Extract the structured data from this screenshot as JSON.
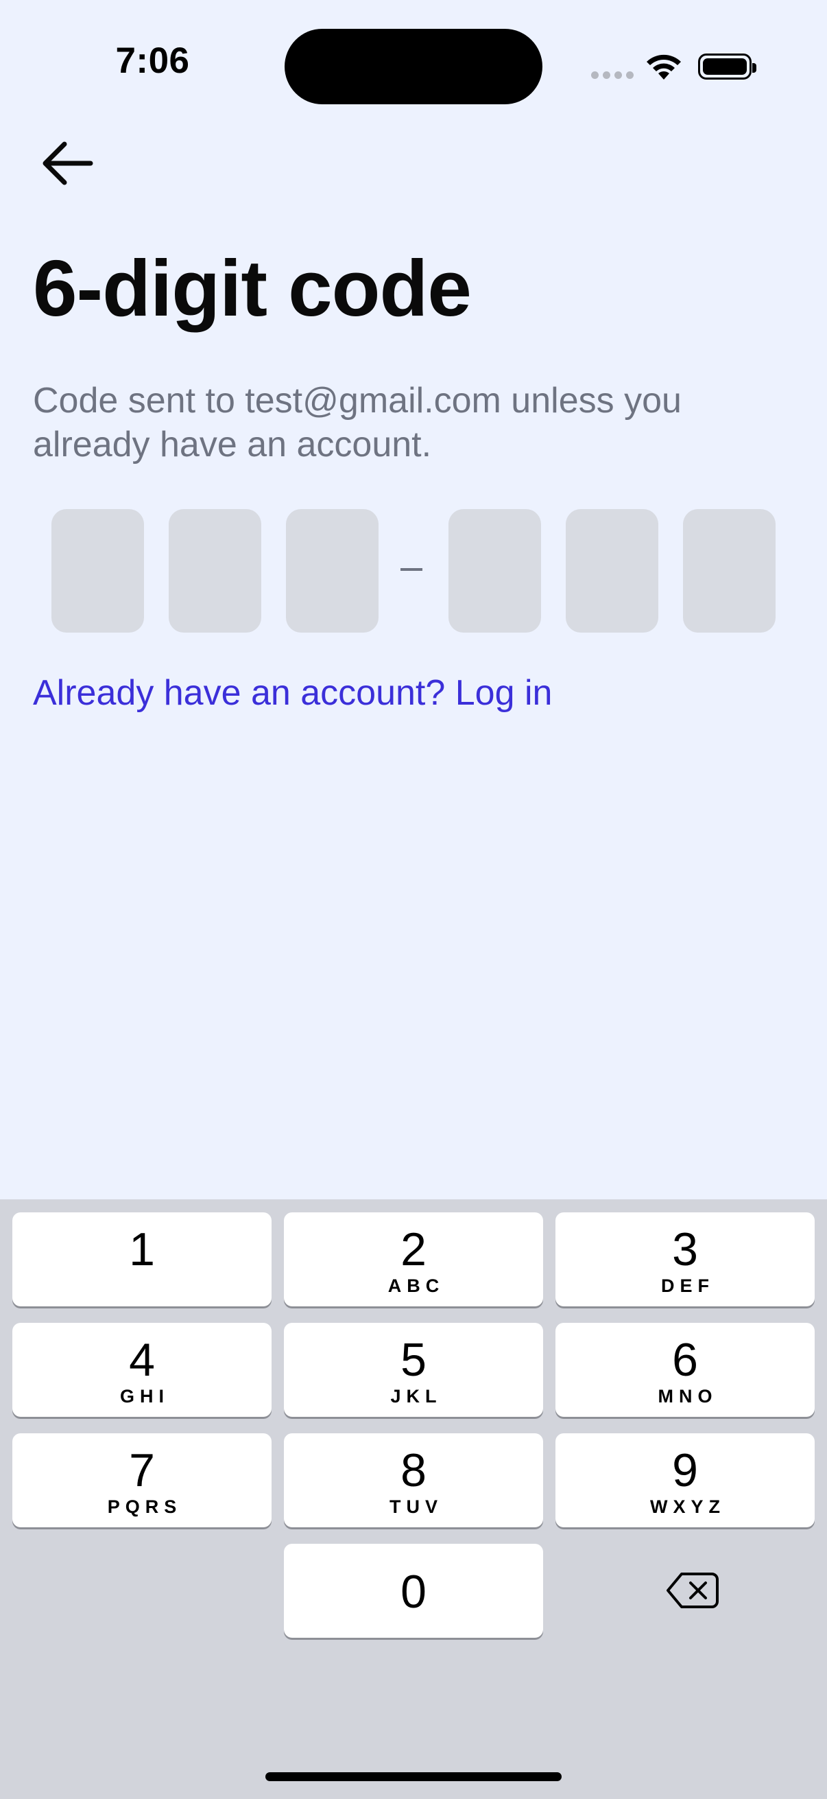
{
  "status_bar": {
    "time": "7:06",
    "signal_icon": "cellular-dots-icon",
    "wifi_icon": "wifi-icon",
    "battery_icon": "battery-full-icon"
  },
  "header": {
    "back_icon": "arrow-left-icon"
  },
  "main": {
    "title": "6-digit code",
    "subtitle": "Code sent to test@gmail.com unless you already have an account.",
    "code_separator": "–",
    "code_digits": [
      "",
      "",
      "",
      "",
      "",
      ""
    ],
    "login_link": "Already have an account? Log in"
  },
  "keypad": {
    "keys": [
      {
        "digit": "1",
        "letters": ""
      },
      {
        "digit": "2",
        "letters": "ABC"
      },
      {
        "digit": "3",
        "letters": "DEF"
      },
      {
        "digit": "4",
        "letters": "GHI"
      },
      {
        "digit": "5",
        "letters": "JKL"
      },
      {
        "digit": "6",
        "letters": "MNO"
      },
      {
        "digit": "7",
        "letters": "PQRS"
      },
      {
        "digit": "8",
        "letters": "TUV"
      },
      {
        "digit": "9",
        "letters": "WXYZ"
      },
      {
        "digit": "0",
        "letters": ""
      }
    ],
    "backspace_icon": "delete-backspace-icon"
  },
  "colors": {
    "background": "#EDF2FE",
    "link": "#3B2FD9",
    "subtitle": "#6E7381",
    "code_box": "#D8DBE2",
    "keypad_bg": "#D2D4DB"
  }
}
